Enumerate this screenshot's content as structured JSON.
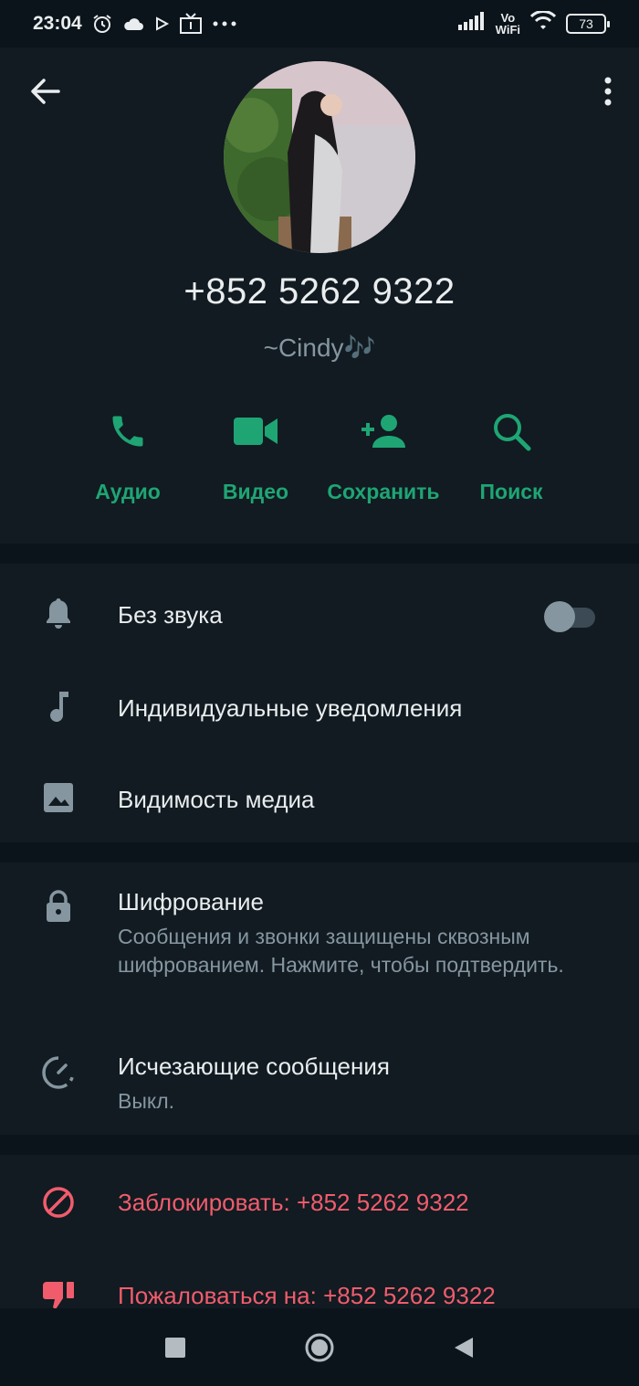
{
  "status_bar": {
    "time": "23:04",
    "vowifi_top": "Vo",
    "vowifi_bottom": "WiFi",
    "battery": "73",
    "icons": [
      "alarm-icon",
      "cloud-icon",
      "play-icon",
      "tv-icon",
      "more-dots-icon",
      "signal-icon",
      "wifi-icon",
      "battery-icon"
    ]
  },
  "contact": {
    "phone": "+852 5262 9322",
    "push_name": "~Cindy🎶"
  },
  "actions": [
    {
      "label": "Аудио",
      "icon": "phone-icon"
    },
    {
      "label": "Видео",
      "icon": "video-icon"
    },
    {
      "label": "Сохранить",
      "icon": "add-person-icon"
    },
    {
      "label": "Поиск",
      "icon": "search-icon"
    }
  ],
  "settings": {
    "mute": {
      "label": "Без звука",
      "enabled": false
    },
    "custom_notifications": {
      "label": "Индивидуальные уведомления"
    },
    "media_visibility": {
      "label": "Видимость медиа"
    }
  },
  "security": {
    "encryption": {
      "title": "Шифрование",
      "subtitle": "Сообщения и звонки защищены сквозным шифрованием. Нажмите, чтобы подтвердить."
    },
    "disappearing": {
      "title": "Исчезающие сообщения",
      "subtitle": "Выкл."
    }
  },
  "danger": {
    "block": "Заблокировать: +852 5262 9322",
    "report": "Пожаловаться на: +852 5262 9322"
  },
  "colors": {
    "background": "#0b141a",
    "panel": "#111b21",
    "accent": "#1fa574",
    "danger": "#f15c6d",
    "muted": "#8696a0"
  }
}
